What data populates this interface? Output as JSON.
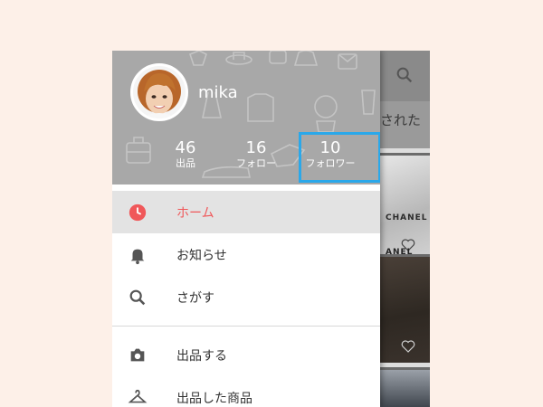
{
  "background": {
    "subheader_text": "された",
    "tile_text_1": "CHANEL",
    "tile_text_2": "ANEL"
  },
  "profile": {
    "username": "mika"
  },
  "stats": [
    {
      "count": "46",
      "label": "出品"
    },
    {
      "count": "16",
      "label": "フォロー"
    },
    {
      "count": "10",
      "label": "フォロワー"
    }
  ],
  "menu": {
    "items": [
      {
        "label": "ホーム",
        "icon": "clock-icon",
        "active": true
      },
      {
        "label": "お知らせ",
        "icon": "bell-icon"
      },
      {
        "label": "さがす",
        "icon": "search-icon"
      },
      {
        "label": "出品する",
        "icon": "camera-icon"
      },
      {
        "label": "出品した商品",
        "icon": "hanger-icon"
      }
    ]
  },
  "colors": {
    "accent": "#f0585a",
    "highlight": "#2aa8ea",
    "header": "#a8a8a8"
  }
}
